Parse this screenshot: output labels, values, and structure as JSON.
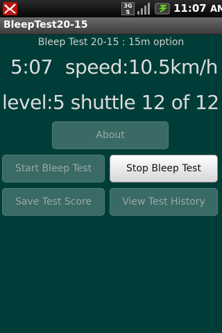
{
  "status_bar": {
    "clock": "11:07",
    "clock_period": "AM",
    "network_label": "3G",
    "icons": [
      "notification-icon",
      "network-3g-icon",
      "signal-icon",
      "battery-icon"
    ]
  },
  "app": {
    "title": "BleepTest20-15"
  },
  "main": {
    "subtitle": "Bleep Test 20-15 : 15m option",
    "time": "5:07",
    "speed": "speed:10.5km/h",
    "level_text": "level:5 shuttle 12 of 12"
  },
  "buttons": {
    "about": "About",
    "start": "Start Bleep Test",
    "stop": "Stop Bleep Test",
    "save": "Save Test Score",
    "history": "View Test History"
  },
  "colors": {
    "background": "#003d38",
    "disabled_button": "#3a6a65",
    "enabled_button": "#f0f0f0"
  }
}
